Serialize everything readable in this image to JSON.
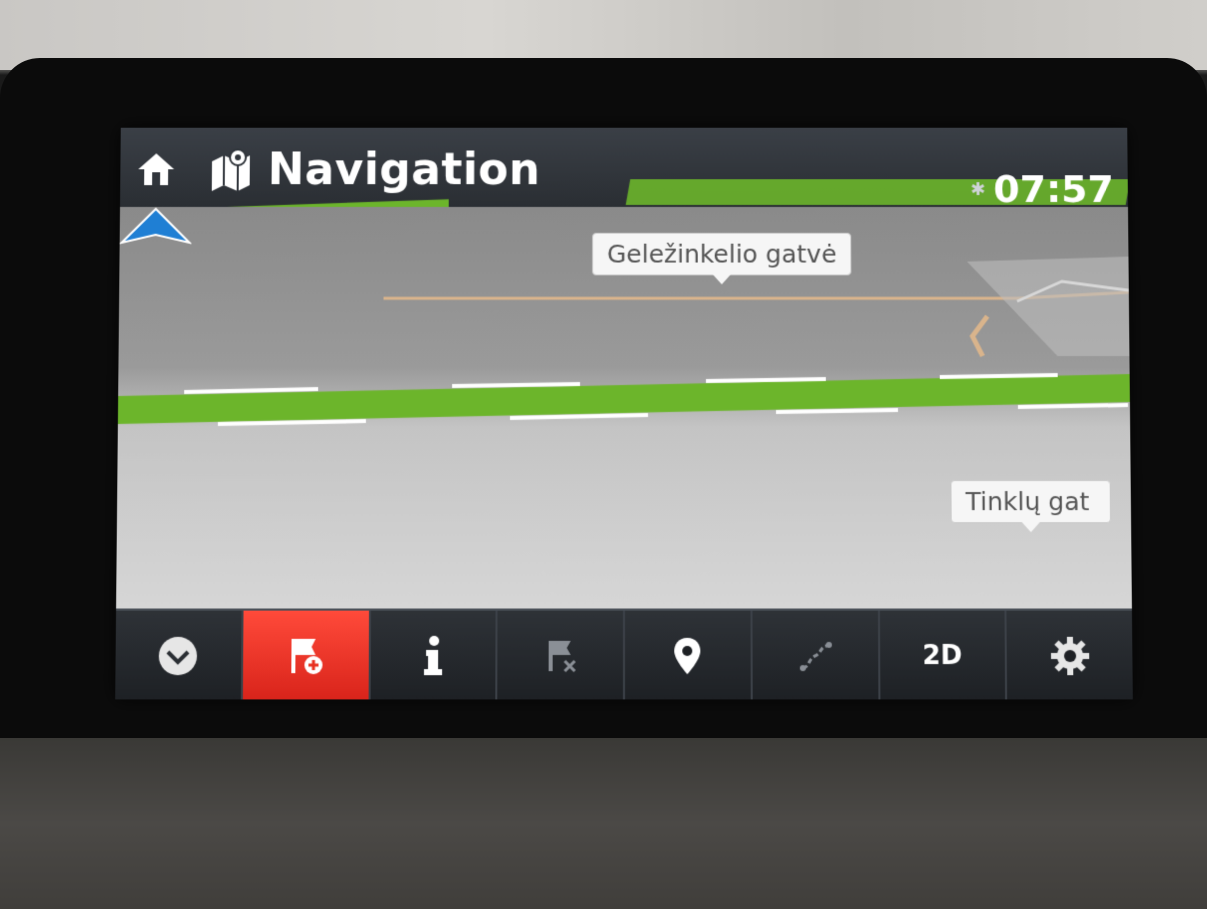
{
  "header": {
    "title": "Navigation",
    "clock": "07:57",
    "bluetooth_icon": "bluetooth-icon"
  },
  "map": {
    "street_labels": [
      "Geležinkelio gatvė",
      "Tinklų gat"
    ],
    "route_color": "#6cb52b",
    "position_arrow_color": "#1f7fd4"
  },
  "toolbar": {
    "items": [
      {
        "icon": "chevron-down-icon",
        "active": false
      },
      {
        "icon": "add-waypoint-flag-icon",
        "active": true
      },
      {
        "icon": "info-icon",
        "active": false
      },
      {
        "icon": "cancel-route-flag-icon",
        "active": false
      },
      {
        "icon": "location-pin-icon",
        "active": false
      },
      {
        "icon": "route-icon",
        "active": false
      },
      {
        "label": "2D",
        "active": false
      },
      {
        "icon": "settings-gear-icon",
        "active": false
      }
    ],
    "active_color": "#e8301f"
  }
}
